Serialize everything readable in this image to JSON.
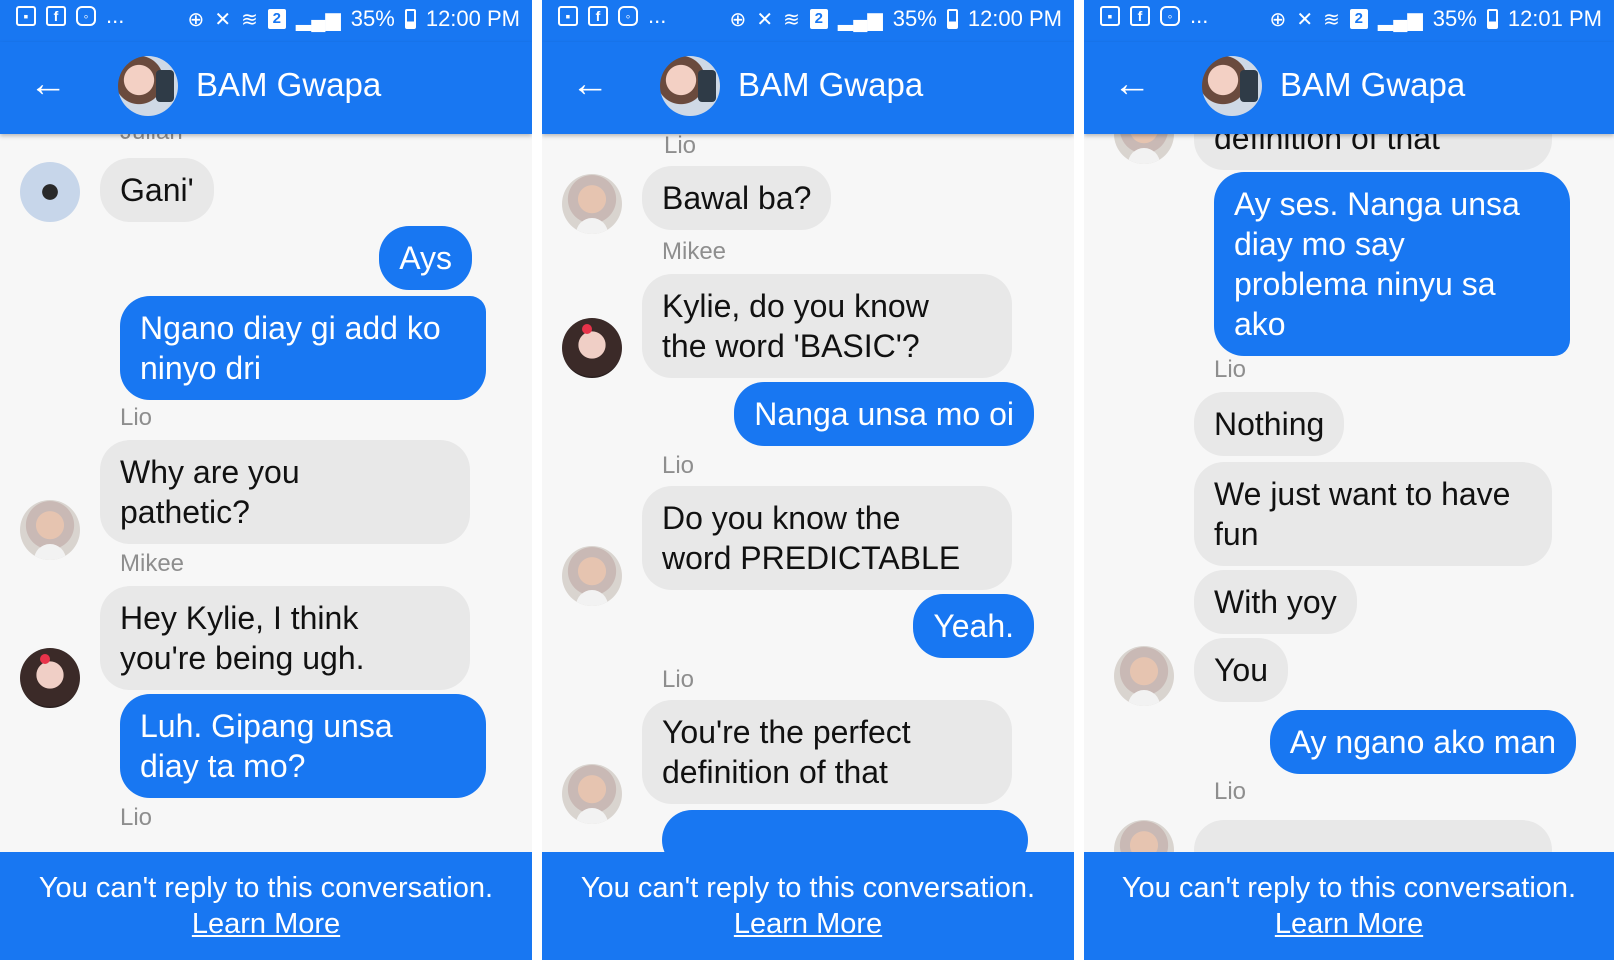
{
  "status_bars": [
    {
      "battery": "35%",
      "time": "12:00 PM",
      "sim": "2",
      "dots": "..."
    },
    {
      "battery": "35%",
      "time": "12:00 PM",
      "sim": "2",
      "dots": "..."
    },
    {
      "battery": "35%",
      "time": "12:01 PM",
      "sim": "2",
      "dots": "..."
    }
  ],
  "status_icons": {
    "left": [
      "image-icon",
      "facebook-icon",
      "instagram-icon"
    ],
    "right": [
      "data-saver-icon",
      "mute-icon",
      "wifi-icon",
      "signal-icon"
    ]
  },
  "header": {
    "title": "BAM Gwapa",
    "back": "←"
  },
  "footer": {
    "text": "You can't reply to this conversation.",
    "link": "Learn More"
  },
  "colors": {
    "accent": "#1877f2",
    "incoming_bubble": "#e8e8e8",
    "background": "#f7f7f7"
  },
  "panels": [
    {
      "senders": [
        "Julian",
        "Lio",
        "Mikee",
        "Lio"
      ],
      "messages": [
        "Gani'",
        "Ays",
        "Ngano diay gi add ko",
        "ninyo dri",
        "Why are you",
        "pathetic?",
        "Hey Kylie, I think",
        "you're being ugh.",
        "Luh.  Gipang unsa",
        "diay ta mo?"
      ]
    },
    {
      "senders": [
        "Lio",
        "Mikee",
        "Lio",
        "Lio"
      ],
      "messages": [
        "Bawal ba?",
        "Kylie, do you know",
        "the word 'BASIC'?",
        "Nanga unsa mo oi",
        "Do you know the",
        "word PREDICTABLE",
        "Yeah.",
        "You're the perfect",
        "definition of that"
      ]
    },
    {
      "senders": [
        "Lio",
        "Lio"
      ],
      "messages": [
        "definition of that",
        "Ay ses. Nanga unsa",
        "diay mo say",
        "problema ninyu sa",
        "ako",
        "Nothing",
        "We just want to have",
        "fun",
        "With yoy",
        "You",
        "Ay ngano ako man"
      ]
    }
  ]
}
